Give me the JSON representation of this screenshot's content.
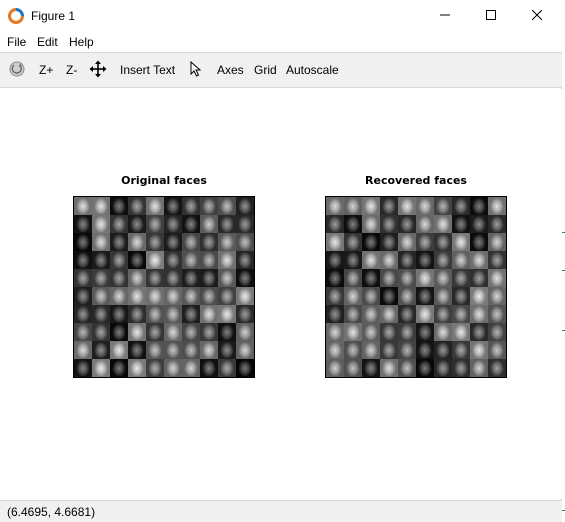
{
  "window": {
    "title": "Figure 1",
    "icon": "octave-logo-icon",
    "controls": [
      "minimize-icon",
      "maximize-icon",
      "close-icon"
    ]
  },
  "menu": {
    "items": [
      {
        "label": "File"
      },
      {
        "label": "Edit"
      },
      {
        "label": "Help"
      }
    ]
  },
  "toolbar": {
    "rotate_icon": "rotate-icon",
    "zoom_in": "Z+",
    "zoom_out": "Z-",
    "pan_icon": "pan-arrows-icon",
    "insert_text": "Insert Text",
    "select_icon": "pointer-icon",
    "axes": "Axes",
    "grid": "Grid",
    "autoscale": "Autoscale"
  },
  "figure": {
    "left_title": "Original faces",
    "right_title": "Recovered faces",
    "grid_size": 10
  },
  "status": {
    "coordinates": "(6.4695, 4.6681)"
  },
  "colors": {
    "toolbar_bg": "#f0f0f0",
    "icon_orange": "#e87722",
    "icon_blue": "#1a73c9"
  }
}
